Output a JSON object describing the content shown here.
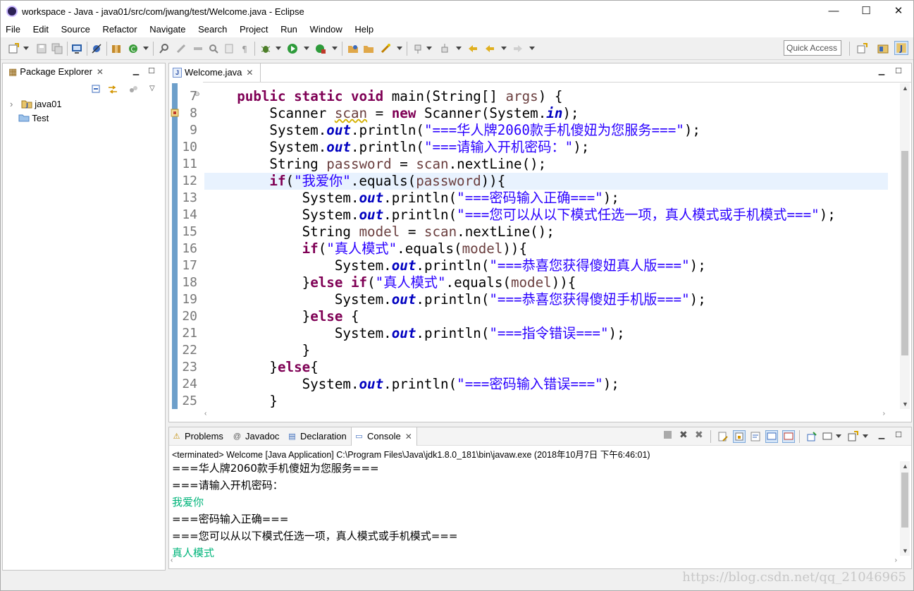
{
  "window": {
    "title": "workspace - Java - java01/src/com/jwang/test/Welcome.java - Eclipse",
    "minimize": "—",
    "maximize": "☐",
    "close": "✕"
  },
  "menu": [
    "File",
    "Edit",
    "Source",
    "Refactor",
    "Navigate",
    "Search",
    "Project",
    "Run",
    "Window",
    "Help"
  ],
  "toolbar": {
    "quick_access_label": "Quick Access"
  },
  "package_explorer": {
    "title": "Package Explorer",
    "items": [
      {
        "label": "java01",
        "icon": "java-project-icon"
      },
      {
        "label": "Test",
        "icon": "folder-icon"
      }
    ]
  },
  "editor": {
    "tab_title": "Welcome.java",
    "tab_icon_glyph": "J",
    "highlighted_line": "12",
    "lines": [
      {
        "num": "7",
        "text": "    public static void main(String[] args) {"
      },
      {
        "num": "8",
        "text": "        Scanner scan = new Scanner(System.in);"
      },
      {
        "num": "9",
        "text": "        System.out.println(\"===华人牌2060款手机傻妞为您服务===\");"
      },
      {
        "num": "10",
        "text": "        System.out.println(\"===请输入开机密码：\");"
      },
      {
        "num": "11",
        "text": "        String password = scan.nextLine();"
      },
      {
        "num": "12",
        "text": "        if(\"我爱你\".equals(password)){"
      },
      {
        "num": "13",
        "text": "            System.out.println(\"===密码输入正确===\");"
      },
      {
        "num": "14",
        "text": "            System.out.println(\"===您可以从以下模式任选一项，真人模式或手机模式===\");"
      },
      {
        "num": "15",
        "text": "            String model = scan.nextLine();"
      },
      {
        "num": "16",
        "text": "            if(\"真人模式\".equals(model)){"
      },
      {
        "num": "17",
        "text": "                System.out.println(\"===恭喜您获得傻妞真人版===\");"
      },
      {
        "num": "18",
        "text": "            }else if(\"真人模式\".equals(model)){"
      },
      {
        "num": "19",
        "text": "                System.out.println(\"===恭喜您获得傻妞手机版===\");"
      },
      {
        "num": "20",
        "text": "            }else {"
      },
      {
        "num": "21",
        "text": "                System.out.println(\"===指令错误===\");"
      },
      {
        "num": "22",
        "text": "            }"
      },
      {
        "num": "23",
        "text": "        }else{"
      },
      {
        "num": "24",
        "text": "            System.out.println(\"===密码输入错误===\");"
      },
      {
        "num": "25",
        "text": "        }"
      }
    ]
  },
  "console": {
    "tabs": [
      {
        "label": "Problems",
        "icon": "problems-icon",
        "glyph": "⚠"
      },
      {
        "label": "Javadoc",
        "icon": "javadoc-icon",
        "glyph": "@"
      },
      {
        "label": "Declaration",
        "icon": "declaration-icon",
        "glyph": "▤"
      },
      {
        "label": "Console",
        "icon": "console-icon",
        "glyph": "▭"
      }
    ],
    "terminated": "<terminated> Welcome [Java Application] C:\\Program Files\\Java\\jdk1.8.0_181\\bin\\javaw.exe (2018年10月7日 下午6:46:01)",
    "lines": [
      {
        "text": "===华人牌2060款手机傻妞为您服务===",
        "input": false
      },
      {
        "text": "===请输入开机密码：",
        "input": false
      },
      {
        "text": "我爱你",
        "input": true
      },
      {
        "text": "===密码输入正确===",
        "input": false
      },
      {
        "text": "===您可以从以下模式任选一项，真人模式或手机模式===",
        "input": false
      },
      {
        "text": "真人模式",
        "input": true
      }
    ]
  },
  "watermark": "https://blog.csdn.net/qq_21046965",
  "colors": {
    "keyword": "#7f0055",
    "string": "#2a00ff",
    "local_var": "#6a3e3e",
    "static_field": "#0000c0",
    "console_input": "#00b47a",
    "current_line": "#e8f2fe"
  }
}
